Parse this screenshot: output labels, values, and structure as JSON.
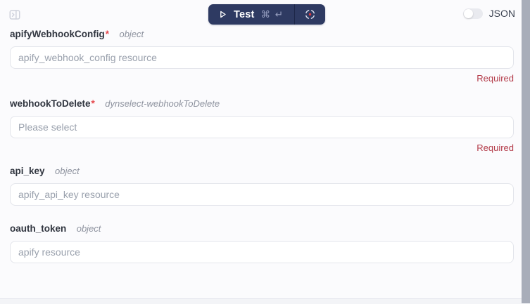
{
  "topbar": {
    "panel_toggle_icon": "collapse-panel",
    "test_button": {
      "label": "Test",
      "shortcut": "⌘ ↵",
      "play_icon": "play"
    },
    "capture_button": {
      "icon": "focus-target"
    },
    "json_toggle": {
      "label": "JSON",
      "state": "off"
    }
  },
  "form": {
    "required_marker": "*",
    "fields": [
      {
        "name": "apifyWebhookConfig",
        "required": true,
        "type": "object",
        "placeholder": "apify_webhook_config resource",
        "error": "Required"
      },
      {
        "name": "webhookToDelete",
        "required": true,
        "type": "dynselect-webhookToDelete",
        "placeholder": "Please select",
        "error": "Required"
      },
      {
        "name": "api_key",
        "required": false,
        "type": "object",
        "placeholder": "apify_api_key resource",
        "error": ""
      },
      {
        "name": "oauth_token",
        "required": false,
        "type": "object",
        "placeholder": "apify resource",
        "error": ""
      }
    ]
  },
  "colors": {
    "accent_navy": "#2e3a62",
    "error_red": "#b33a48",
    "asterisk_red": "#e5484d",
    "scrollbar_gray": "#a8adb9"
  }
}
